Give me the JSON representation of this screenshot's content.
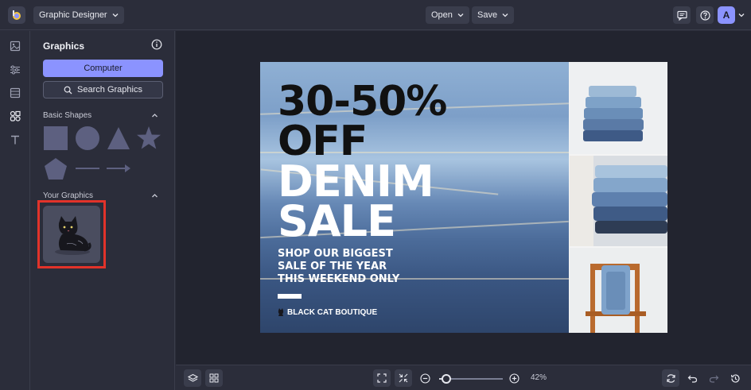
{
  "app": {
    "mode_label": "Graphic Designer",
    "open_label": "Open",
    "save_label": "Save",
    "avatar_letter": "A"
  },
  "panel": {
    "title": "Graphics",
    "computer_button": "Computer",
    "search_button": "Search Graphics",
    "basic_shapes_label": "Basic Shapes",
    "your_graphics_label": "Your Graphics"
  },
  "design": {
    "headline_1": "30-50%",
    "headline_2": "OFF",
    "headline_3": "DENIM",
    "headline_4": "SALE",
    "sub_1": "SHOP OUR BIGGEST",
    "sub_2": "SALE OF THE YEAR",
    "sub_3": "THIS WEEKEND ONLY",
    "brand": "BLACK CAT BOUTIQUE"
  },
  "zoom": {
    "percent_text": "42%",
    "level": 0.42
  },
  "colors": {
    "accent": "#8b93ff",
    "highlight": "#e2332a",
    "shape_fill": "#5d6080"
  },
  "icons": {
    "rail": [
      "image-icon",
      "sliders-icon",
      "layout-icon",
      "graphics-icon",
      "text-icon"
    ],
    "topbar": [
      "comment-icon",
      "help-icon"
    ],
    "bottom": [
      "layers-icon",
      "grid-icon",
      "fit-screen-icon",
      "shrink-icon",
      "zoom-out-icon",
      "zoom-in-icon",
      "refresh-icon",
      "undo-icon",
      "redo-icon",
      "history-icon"
    ]
  }
}
